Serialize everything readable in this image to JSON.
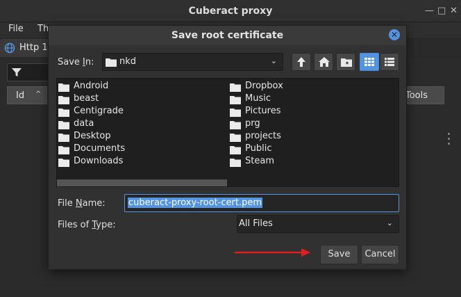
{
  "app": {
    "title": "Cuberact proxy",
    "menu": [
      "File",
      "Th"
    ],
    "tab_label": "Http 1",
    "columns": [
      "Id",
      "Tools"
    ]
  },
  "dialog": {
    "title": "Save root certificate",
    "save_in_label": "Save In:",
    "save_in_value": "nkd",
    "files_left": [
      "Android",
      "beast",
      "Centigrade",
      "data",
      "Desktop",
      "Documents",
      "Downloads"
    ],
    "files_right": [
      "Dropbox",
      "Music",
      "Pictures",
      "prg",
      "projects",
      "Public",
      "Steam"
    ],
    "file_name_label": "File Name:",
    "file_name_value": "cuberact-proxy-root-cert.pem",
    "files_of_type_label": "Files of Type:",
    "files_of_type_value": "All Files",
    "save_button": "Save",
    "cancel_button": "Cancel"
  },
  "icons": {
    "up": "up-folder-icon",
    "home": "home-icon",
    "new_folder": "new-folder-icon",
    "list_view": "list-view-icon",
    "details_view": "details-view-icon",
    "folder": "folder-icon"
  },
  "colors": {
    "accent": "#5294e2",
    "annotation_arrow": "#e02020"
  }
}
